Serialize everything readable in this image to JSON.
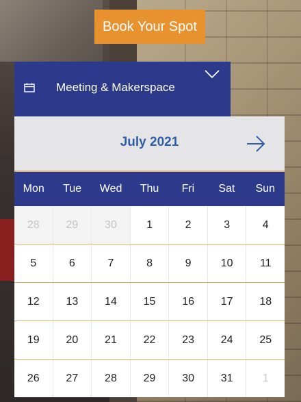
{
  "booking": {
    "button_label": "Book Your Spot"
  },
  "space_selector": {
    "value": "Meeting & Makerspace",
    "icon": "calendar-icon",
    "dropdown_icon": "chevron-down-icon"
  },
  "calendar": {
    "month_title": "July 2021",
    "next_icon": "arrow-right-icon",
    "days_of_week": [
      "Mon",
      "Tue",
      "Wed",
      "Thu",
      "Fri",
      "Sat",
      "Sun"
    ],
    "weeks": [
      [
        "28",
        "29",
        "30",
        "1",
        "2",
        "3",
        "4"
      ],
      [
        "5",
        "6",
        "7",
        "8",
        "9",
        "10",
        "11"
      ],
      [
        "12",
        "13",
        "14",
        "15",
        "16",
        "17",
        "18"
      ],
      [
        "19",
        "20",
        "21",
        "22",
        "23",
        "24",
        "25"
      ],
      [
        "26",
        "27",
        "28",
        "29",
        "30",
        "31",
        "1"
      ]
    ]
  },
  "colors": {
    "header_blue": "#2d3a8c",
    "accent_orange": "#e8912f",
    "month_text": "#2f5ea9",
    "row_divider": "#e0b06a"
  }
}
